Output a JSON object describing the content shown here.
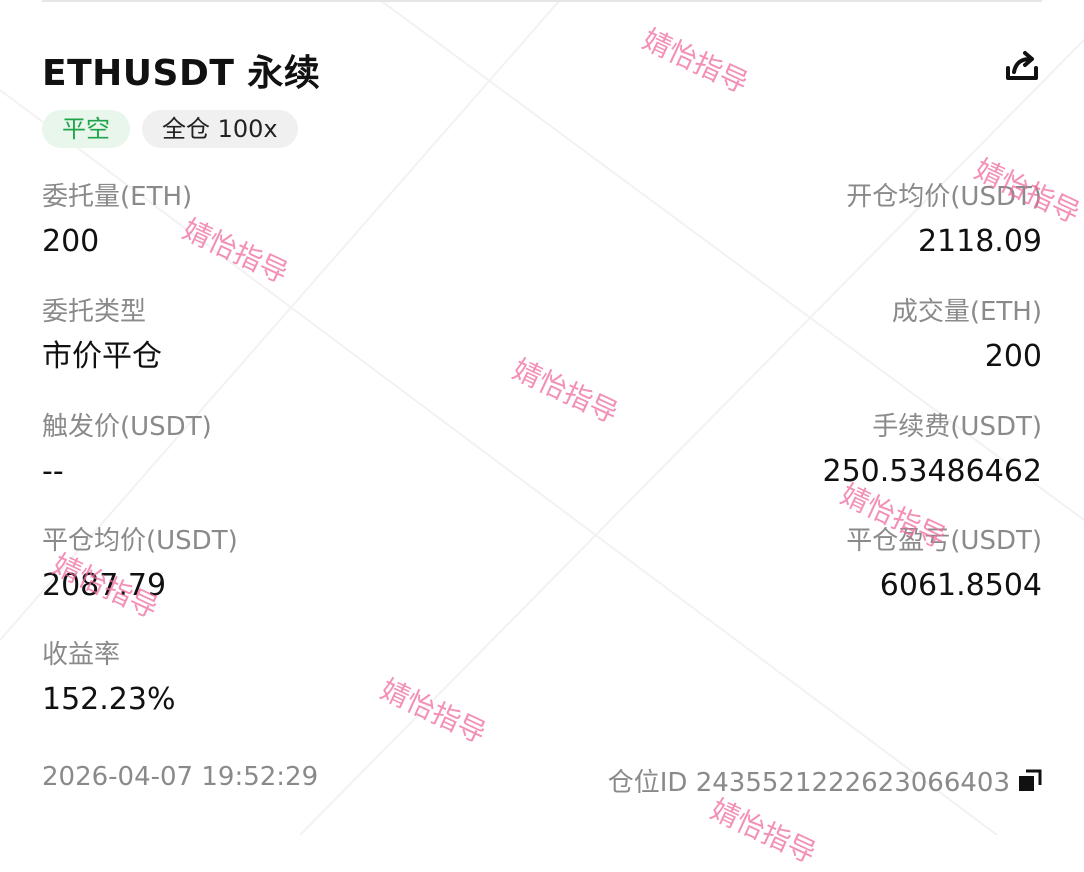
{
  "header": {
    "title": "ETHUSDT 永续",
    "tags": {
      "direction": "平空",
      "margin": "全仓 100x"
    }
  },
  "fields": {
    "order_qty": {
      "label": "委托量(ETH)",
      "value": "200"
    },
    "open_avg_price": {
      "label": "开仓均价(USDT)",
      "value": "2118.09"
    },
    "order_type": {
      "label": "委托类型",
      "value": "市价平仓"
    },
    "filled_qty": {
      "label": "成交量(ETH)",
      "value": "200"
    },
    "trigger_price": {
      "label": "触发价(USDT)",
      "value": "--"
    },
    "fee": {
      "label": "手续费(USDT)",
      "value": "250.53486462"
    },
    "close_avg_price": {
      "label": "平仓均价(USDT)",
      "value": "2087.79"
    },
    "close_pnl": {
      "label": "平仓盈亏(USDT)",
      "value": "6061.8504"
    },
    "roi": {
      "label": "收益率",
      "value": "152.23%"
    }
  },
  "footer": {
    "timestamp": "2026-04-07 19:52:29",
    "position_id": "仓位ID 2435521222623066403"
  },
  "watermark": "婧怡指导",
  "colors": {
    "close_tag_text": "#20a44a",
    "close_tag_bg": "#e8f6ec",
    "watermark": "#f06ba0"
  },
  "icons": {
    "share": "share-icon",
    "copy": "copy-icon"
  }
}
